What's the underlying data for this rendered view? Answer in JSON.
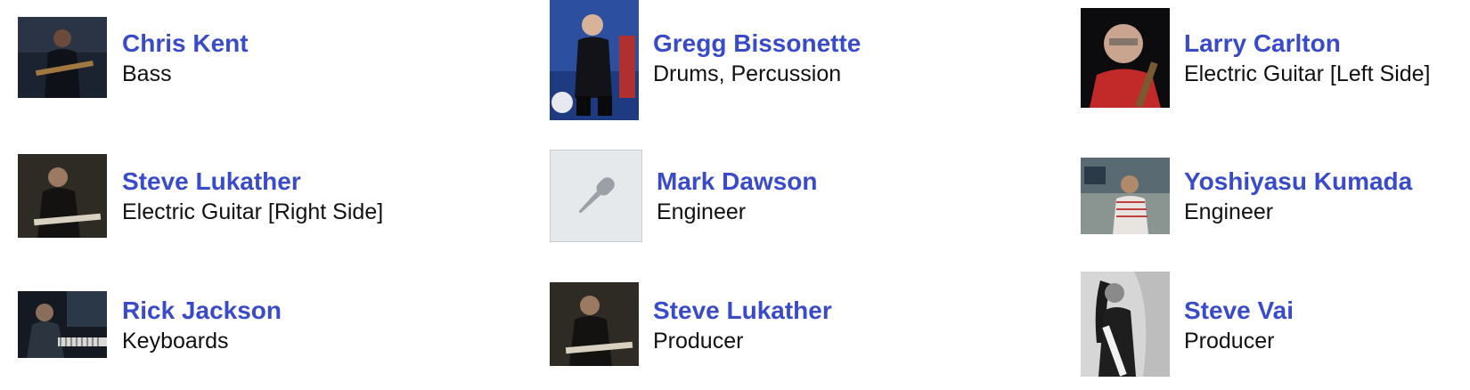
{
  "colors": {
    "link": "#3a4bc9",
    "role_text": "#111111",
    "placeholder_bg": "#e6e9ec",
    "placeholder_icon": "#9aa0a6"
  },
  "credits": [
    {
      "name": "Chris Kent",
      "role": "Bass",
      "photo": "musician-photo"
    },
    {
      "name": "Gregg Bissonette",
      "role": "Drums, Percussion",
      "photo": "musician-photo"
    },
    {
      "name": "Larry Carlton",
      "role": "Electric Guitar [Left Side]",
      "photo": "musician-photo"
    },
    {
      "name": "Steve Lukather",
      "role": "Electric Guitar [Right Side]",
      "photo": "musician-photo"
    },
    {
      "name": "Mark Dawson",
      "role": "Engineer",
      "photo": "microphone-icon"
    },
    {
      "name": "Yoshiyasu Kumada",
      "role": "Engineer",
      "photo": "musician-photo"
    },
    {
      "name": "Rick Jackson",
      "role": "Keyboards",
      "photo": "musician-photo"
    },
    {
      "name": "Steve Lukather",
      "role": "Producer",
      "photo": "musician-photo"
    },
    {
      "name": "Steve Vai",
      "role": "Producer",
      "photo": "musician-photo"
    }
  ]
}
